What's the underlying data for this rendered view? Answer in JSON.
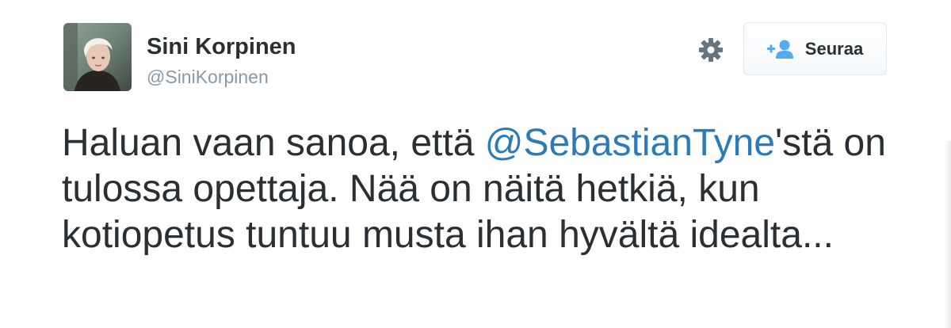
{
  "user": {
    "name": "Sini Korpinen",
    "handle": "@SiniKorpinen"
  },
  "actions": {
    "settings_icon": "gear-icon",
    "follow_icon": "add-user-icon",
    "follow_label": "Seuraa"
  },
  "tweet": {
    "text_before": "Haluan vaan sanoa, että ",
    "mention": "@SebastianTyne",
    "text_after": "'stä on tulossa opettaja. Nää on näitä hetkiä, kun kotiopetus tuntuu musta ihan hyvältä idealta..."
  },
  "colors": {
    "text": "#292f33",
    "secondary": "#8899a6",
    "link": "#2b7bb9",
    "follow_icon": "#55acee",
    "gear": "#66757f"
  }
}
